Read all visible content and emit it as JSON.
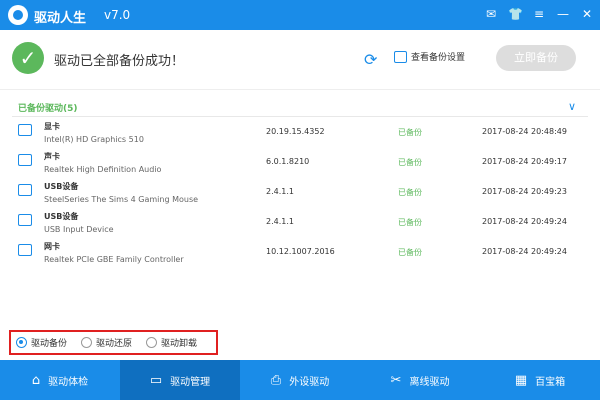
{
  "titlebar": {
    "title": "驱动人生",
    "version": "v7.0"
  },
  "status": {
    "message": "驱动已全部备份成功！",
    "view_settings": "查看备份设置",
    "backup_button": "立即备份"
  },
  "section": {
    "header": "已备份驱动(5)"
  },
  "drivers": [
    {
      "category": "显卡",
      "name": "Intel(R) HD Graphics 510",
      "version": "20.19.15.4352",
      "status": "已备份",
      "time": "2017-08-24 20:48:49",
      "icon": "monitor-icon"
    },
    {
      "category": "声卡",
      "name": "Realtek High Definition Audio",
      "version": "6.0.1.8210",
      "status": "已备份",
      "time": "2017-08-24 20:49:17",
      "icon": "speaker-icon"
    },
    {
      "category": "USB设备",
      "name": "SteelSeries The Sims 4 Gaming Mouse",
      "version": "2.4.1.1",
      "status": "已备份",
      "time": "2017-08-24 20:49:23",
      "icon": "usb-device-icon"
    },
    {
      "category": "USB设备",
      "name": "USB Input Device",
      "version": "2.4.1.1",
      "status": "已备份",
      "time": "2017-08-24 20:49:24",
      "icon": "usb-device-icon"
    },
    {
      "category": "网卡",
      "name": "Realtek PCIe GBE Family Controller",
      "version": "10.12.1007.2016",
      "status": "已备份",
      "time": "2017-08-24 20:49:24",
      "icon": "network-card-icon"
    }
  ],
  "options": [
    "驱动备份",
    "驱动还原",
    "驱动卸载"
  ],
  "nav": [
    {
      "label": "驱动体检",
      "icon": "home-icon"
    },
    {
      "label": "驱动管理",
      "icon": "laptop-icon"
    },
    {
      "label": "外设驱动",
      "icon": "printer-icon"
    },
    {
      "label": "离线驱动",
      "icon": "tools-icon"
    },
    {
      "label": "百宝箱",
      "icon": "toolbox-icon"
    }
  ],
  "colors": {
    "brand": "#1a8ce8",
    "success": "#5cb85c",
    "highlight": "#e02020"
  }
}
